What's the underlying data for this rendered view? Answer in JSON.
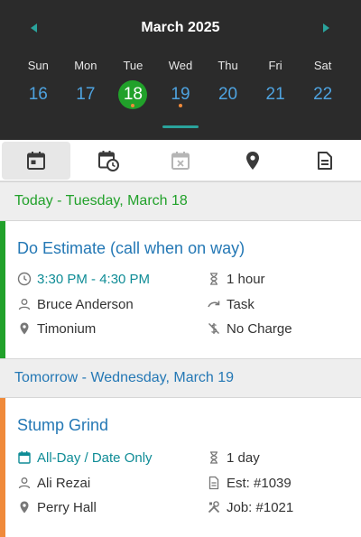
{
  "calendar": {
    "month_label": "March 2025",
    "days": [
      {
        "name": "Sun",
        "num": "16"
      },
      {
        "name": "Mon",
        "num": "17"
      },
      {
        "name": "Tue",
        "num": "18"
      },
      {
        "name": "Wed",
        "num": "19"
      },
      {
        "name": "Thu",
        "num": "20"
      },
      {
        "name": "Fri",
        "num": "21"
      },
      {
        "name": "Sat",
        "num": "22"
      }
    ],
    "selected_day": "18",
    "accent_color": "#2aa39c",
    "selected_color": "#21a12a",
    "event_dot_color": "#f08a3a"
  },
  "tabs": [
    {
      "icon": "calendar-day-icon",
      "active": true
    },
    {
      "icon": "calendar-clock-icon",
      "active": false
    },
    {
      "icon": "calendar-cancel-icon",
      "active": false
    },
    {
      "icon": "map-pin-icon",
      "active": false
    },
    {
      "icon": "document-icon",
      "active": false
    }
  ],
  "today_header": "Today - Tuesday, March 18",
  "tomorrow_header": "Tomorrow - Wednesday, March 19",
  "events": [
    {
      "title": "Do Estimate (call when on way)",
      "time": "3:30 PM - 4:30 PM",
      "duration": "1 hour",
      "person": "Bruce Anderson",
      "type": "Task",
      "location": "Timonium",
      "charge": "No Charge",
      "bar_color": "#21a12a"
    },
    {
      "title": "Stump Grind",
      "time": "All-Day / Date Only",
      "duration": "1 day",
      "person": "Ali Rezai",
      "estimate": "Est: #1039",
      "location": "Perry Hall",
      "job": "Job: #1021",
      "bar_color": "#f08a3a"
    }
  ]
}
